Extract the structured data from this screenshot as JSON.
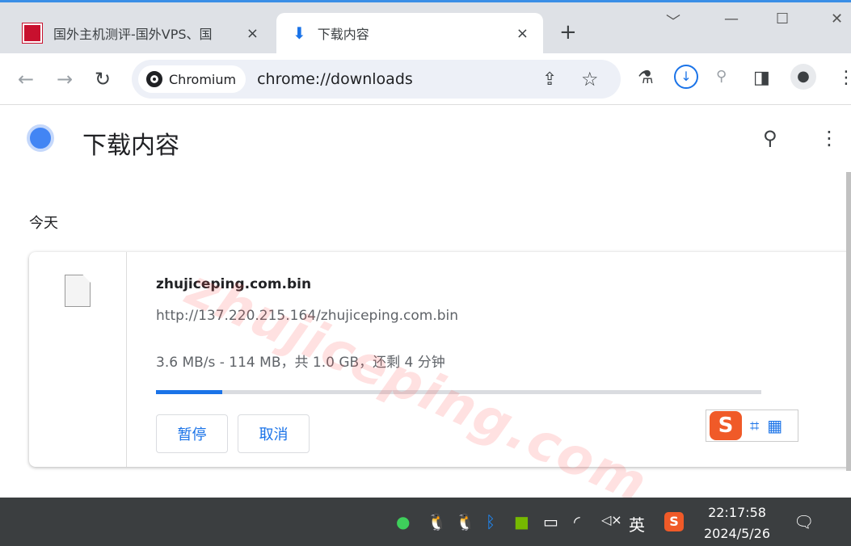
{
  "browser": {
    "tabs": [
      {
        "label": "国外主机测评-国外VPS、国",
        "active": false
      },
      {
        "label": "下载内容",
        "active": true
      }
    ],
    "new_tab": "+",
    "close": "×",
    "window": {
      "minimize": "﹀",
      "maximize": "—",
      "restore": "☐",
      "close": "✕"
    },
    "site_chip": "Chromium",
    "url": "chrome://downloads"
  },
  "page": {
    "title": "下载内容",
    "date_group": "今天"
  },
  "download": {
    "filename": "zhujiceping.com.bin",
    "url": "http://137.220.215.164/zhujiceping.com.bin",
    "status": "3.6 MB/s - 114 MB，共 1.0 GB，还剩 4 分钟",
    "progress_percent": 11,
    "pause": "暂停",
    "cancel": "取消"
  },
  "watermark": "zhujiceping.com",
  "ime": {
    "logo": "S"
  },
  "taskbar": {
    "ime_lang": "英",
    "time": "22:17:58",
    "date": "2024/5/26"
  },
  "colors": {
    "accent": "#1a73e8",
    "taskbar": "#3b3e40"
  }
}
